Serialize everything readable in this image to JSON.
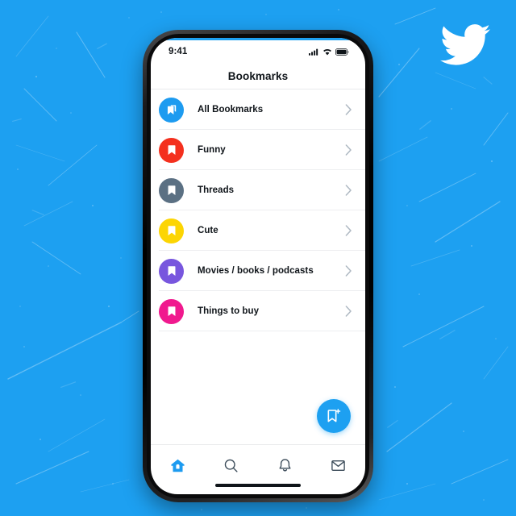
{
  "background": {
    "color": "#1DA0F1",
    "texture": "grunge-scratches"
  },
  "brand": {
    "logo_icon": "twitter-bird-icon",
    "logo_color": "#FFFFFF"
  },
  "phone": {
    "status_bar": {
      "time": "9:41",
      "cellular_icon": "signal-bars-icon",
      "wifi_icon": "wifi-icon",
      "battery_icon": "battery-icon"
    },
    "home_indicator": "home-indicator-bar"
  },
  "header": {
    "title": "Bookmarks"
  },
  "list": {
    "items": [
      {
        "label": "All Bookmarks",
        "color": "#1D9BF0",
        "icon": "bookmarks-stack-icon",
        "chevron": "chevron-right-icon"
      },
      {
        "label": "Funny",
        "color": "#F4301E",
        "icon": "bookmark-icon",
        "chevron": "chevron-right-icon"
      },
      {
        "label": "Threads",
        "color": "#5B7083",
        "icon": "bookmark-icon",
        "chevron": "chevron-right-icon"
      },
      {
        "label": "Cute",
        "color": "#FCD503",
        "icon": "bookmark-icon",
        "chevron": "chevron-right-icon"
      },
      {
        "label": "Movies / books / podcasts",
        "color": "#7856DE",
        "icon": "bookmark-icon",
        "chevron": "chevron-right-icon"
      },
      {
        "label": "Things to buy",
        "color": "#F0198E",
        "icon": "bookmark-icon",
        "chevron": "chevron-right-icon"
      }
    ]
  },
  "fab": {
    "icon": "add-bookmark-icon",
    "color": "#1DA0F1"
  },
  "bottom_nav": {
    "items": [
      {
        "icon": "home-icon",
        "active": true
      },
      {
        "icon": "search-icon",
        "active": false
      },
      {
        "icon": "notifications-bell-icon",
        "active": false
      },
      {
        "icon": "messages-envelope-icon",
        "active": false
      }
    ],
    "active_color": "#1D9BF0",
    "inactive_color": "#3A4A58"
  }
}
